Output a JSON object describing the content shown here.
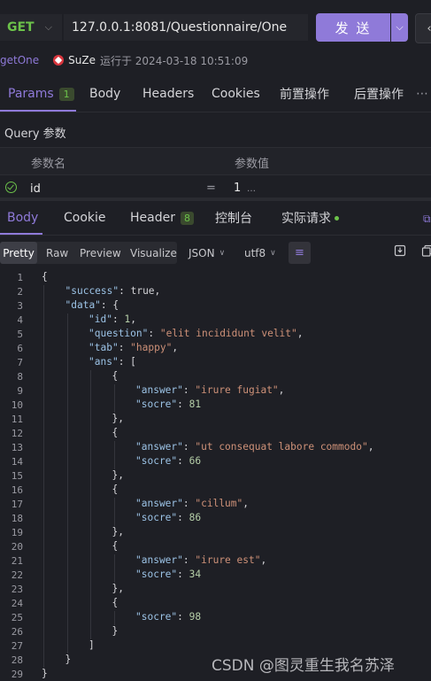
{
  "request": {
    "method": "GET",
    "url": "127.0.0.1:8081/Questionnaire/One",
    "send_label": "发 送",
    "api_name": "getOne",
    "author": "SuZe",
    "run_text": "运行于 2024-03-18 10:51:09"
  },
  "param_tabs": [
    {
      "label": "Params",
      "badge": "1"
    },
    {
      "label": "Body"
    },
    {
      "label": "Headers"
    },
    {
      "label": "Cookies"
    },
    {
      "label": "前置操作"
    },
    {
      "label": "后置操作"
    }
  ],
  "query": {
    "title": "Query 参数",
    "col_name": "参数名",
    "col_value": "参数值",
    "row": {
      "key": "id",
      "eq": "=",
      "value": "1"
    }
  },
  "response_tabs": [
    {
      "label": "Body"
    },
    {
      "label": "Cookie"
    },
    {
      "label": "Header",
      "badge": "8"
    },
    {
      "label": "控制台"
    },
    {
      "label": "实际请求"
    }
  ],
  "toolbar": {
    "views": [
      "Pretty",
      "Raw",
      "Preview",
      "Visualize"
    ],
    "format": "JSON",
    "encoding": "utf8"
  },
  "code_lines": [
    {
      "n": "1",
      "i": 0,
      "html": "{"
    },
    {
      "n": "2",
      "i": 1,
      "html": "<span class='k'>\"success\"</span>: true,"
    },
    {
      "n": "3",
      "i": 1,
      "html": "<span class='k'>\"data\"</span>: {"
    },
    {
      "n": "4",
      "i": 2,
      "html": "<span class='k'>\"id\"</span>: <span class='n'>1</span>,"
    },
    {
      "n": "5",
      "i": 2,
      "html": "<span class='k'>\"question\"</span>: <span class='s'>\"elit incididunt velit\"</span>,"
    },
    {
      "n": "6",
      "i": 2,
      "html": "<span class='k'>\"tab\"</span>: <span class='s'>\"happy\"</span>,"
    },
    {
      "n": "7",
      "i": 2,
      "html": "<span class='k'>\"ans\"</span>: ["
    },
    {
      "n": "8",
      "i": 3,
      "html": "{"
    },
    {
      "n": "9",
      "i": 4,
      "html": "<span class='k'>\"answer\"</span>: <span class='s'>\"irure fugiat\"</span>,"
    },
    {
      "n": "10",
      "i": 4,
      "html": "<span class='k'>\"socre\"</span>: <span class='n'>81</span>"
    },
    {
      "n": "11",
      "i": 3,
      "html": "},"
    },
    {
      "n": "12",
      "i": 3,
      "html": "{"
    },
    {
      "n": "13",
      "i": 4,
      "html": "<span class='k'>\"answer\"</span>: <span class='s'>\"ut consequat labore commodo\"</span>,"
    },
    {
      "n": "14",
      "i": 4,
      "html": "<span class='k'>\"socre\"</span>: <span class='n'>66</span>"
    },
    {
      "n": "15",
      "i": 3,
      "html": "},"
    },
    {
      "n": "16",
      "i": 3,
      "html": "{"
    },
    {
      "n": "17",
      "i": 4,
      "html": "<span class='k'>\"answer\"</span>: <span class='s'>\"cillum\"</span>,"
    },
    {
      "n": "18",
      "i": 4,
      "html": "<span class='k'>\"socre\"</span>: <span class='n'>86</span>"
    },
    {
      "n": "19",
      "i": 3,
      "html": "},"
    },
    {
      "n": "20",
      "i": 3,
      "html": "{"
    },
    {
      "n": "21",
      "i": 4,
      "html": "<span class='k'>\"answer\"</span>: <span class='s'>\"irure est\"</span>,"
    },
    {
      "n": "22",
      "i": 4,
      "html": "<span class='k'>\"socre\"</span>: <span class='n'>34</span>"
    },
    {
      "n": "23",
      "i": 3,
      "html": "},"
    },
    {
      "n": "24",
      "i": 3,
      "html": "{"
    },
    {
      "n": "25",
      "i": 4,
      "html": "<span class='k'>\"socre\"</span>: <span class='n'>98</span>"
    },
    {
      "n": "26",
      "i": 3,
      "html": "}"
    },
    {
      "n": "27",
      "i": 2,
      "html": "]"
    },
    {
      "n": "28",
      "i": 1,
      "html": "}"
    },
    {
      "n": "29",
      "i": 0,
      "html": "}"
    }
  ],
  "watermark": "CSDN @图灵重生我名苏泽",
  "colors": {
    "accent": "#8f7ad9",
    "method_green": "#6cc24a",
    "background": "#1e1f25"
  }
}
